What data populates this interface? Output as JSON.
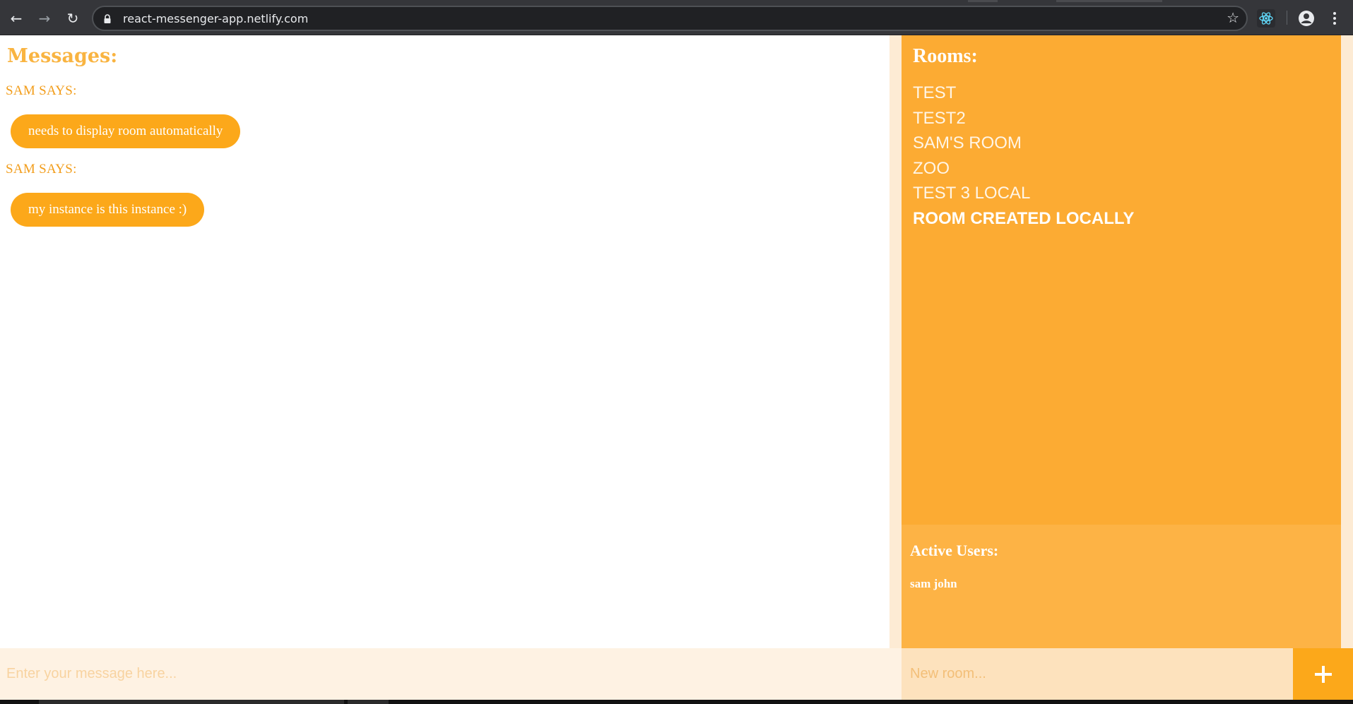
{
  "browser": {
    "url": "react-messenger-app.netlify.com",
    "nav": {
      "back_icon": "←",
      "forward_icon": "→",
      "reload_icon": "↻"
    },
    "bookmark_icon": "☆"
  },
  "messages": {
    "heading": "Messages:",
    "items": [
      {
        "sender": "SAM SAYS:",
        "text": "needs to display room automatically"
      },
      {
        "sender": "SAM SAYS:",
        "text": "my instance is this instance :)"
      }
    ]
  },
  "rooms": {
    "heading": "Rooms:",
    "items": [
      {
        "label": "TEST"
      },
      {
        "label": "TEST2"
      },
      {
        "label": "SAM'S ROOM"
      },
      {
        "label": "ZOO"
      },
      {
        "label": "TEST 3 LOCAL"
      },
      {
        "label": "ROOM CREATED LOCALLY",
        "active": true
      }
    ]
  },
  "active_users": {
    "heading": "Active Users:",
    "users": [
      "sam john"
    ]
  },
  "composer": {
    "message_placeholder": "Enter your message here...",
    "room_placeholder": "New room..."
  },
  "colors": {
    "accent": "#fca81a",
    "sidebar": "#fcab33",
    "sender_text": "#f29d1b"
  }
}
